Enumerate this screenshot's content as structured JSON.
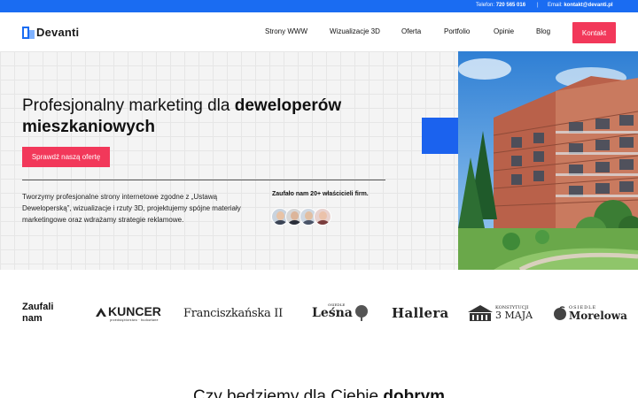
{
  "topbar": {
    "phone_label": "Telefon:",
    "phone_value": "720 565 016",
    "separator": "|",
    "email_label": "Email:",
    "email_value": "kontakt@devanti.pl",
    "color": "#1a6cf2"
  },
  "nav": {
    "logo": "Devanti",
    "items": [
      "Strony WWW",
      "Wizualizacje 3D",
      "Oferta",
      "Portfolio",
      "Opinie",
      "Blog"
    ],
    "contact_button": "Kontakt"
  },
  "hero": {
    "title_regular": "Profesjonalny marketing dla",
    "title_bold_1": "deweloperów",
    "title_bold_2": "mieszkaniowych",
    "cta": "Sprawdź naszą ofertę",
    "description": "Tworzymy profesjonalne strony internetowe zgodne z „Ustawą Deweloperską”, wizualizacje i rzuty 3D, projektujemy spójne materiały marketingowe oraz wdrażamy strategie reklamowe.",
    "trust_text": "Zaufało nam 20+ właścicieli firm.",
    "avatars": [
      "avatar-1",
      "avatar-2",
      "avatar-3",
      "avatar-4"
    ],
    "accent": "#f2385a"
  },
  "clients": {
    "label": "Zaufali nam",
    "logos": [
      {
        "name": "KUNCER",
        "sub": "przedsiębiorstwo · budowlane"
      },
      {
        "name": "Franciszkańska II"
      },
      {
        "name": "Leśna",
        "pre": "OSIEDLE"
      },
      {
        "name": "Hallera"
      },
      {
        "name": "3 MAJA",
        "pre": "KONSTYTUCJI"
      },
      {
        "name": "Morelowa",
        "pre": "OSIEDLE"
      }
    ]
  },
  "next_section": {
    "title_regular": "Czy będziemy dla Ciebie",
    "title_bold": "dobrym"
  }
}
